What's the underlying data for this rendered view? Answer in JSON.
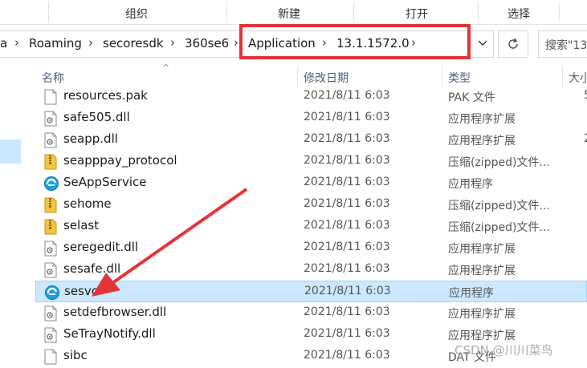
{
  "ribbon": {
    "groups": [
      "组织",
      "新建",
      "打开",
      "选择"
    ]
  },
  "address": {
    "crumbs": [
      "a",
      "Roaming",
      "secoresdk",
      "360se6",
      "Application",
      "13.1.1572.0"
    ]
  },
  "search": {
    "placeholder": "搜索\"13"
  },
  "columns": {
    "name": "名称",
    "date": "修改日期",
    "type": "类型",
    "size": "大小"
  },
  "files": [
    {
      "name": "resources.pak",
      "date": "2021/8/11 6:03",
      "type": "PAK 文件",
      "size": "5",
      "icon": "file-icon"
    },
    {
      "name": "safe505.dll",
      "date": "2021/8/11 6:03",
      "type": "应用程序扩展",
      "size": "",
      "icon": "dll-icon"
    },
    {
      "name": "seapp.dll",
      "date": "2021/8/11 6:03",
      "type": "应用程序扩展",
      "size": "2",
      "icon": "dll-icon"
    },
    {
      "name": "seapppay_protocol",
      "date": "2021/8/11 6:03",
      "type": "压缩(zipped)文件...",
      "size": "",
      "icon": "zip-icon"
    },
    {
      "name": "SeAppService",
      "date": "2021/8/11 6:03",
      "type": "应用程序",
      "size": "",
      "icon": "app-icon"
    },
    {
      "name": "sehome",
      "date": "2021/8/11 6:03",
      "type": "压缩(zipped)文件...",
      "size": "",
      "icon": "zip-icon"
    },
    {
      "name": "selast",
      "date": "2021/8/11 6:03",
      "type": "压缩(zipped)文件...",
      "size": "",
      "icon": "zip-icon"
    },
    {
      "name": "seregedit.dll",
      "date": "2021/8/11 6:03",
      "type": "应用程序扩展",
      "size": "",
      "icon": "dll-icon"
    },
    {
      "name": "sesafe.dll",
      "date": "2021/8/11 6:03",
      "type": "应用程序扩展",
      "size": "",
      "icon": "dll-icon"
    },
    {
      "name": "sesvc",
      "date": "2021/8/11 6:03",
      "type": "应用程序",
      "size": "",
      "icon": "app-icon",
      "selected": true
    },
    {
      "name": "setdefbrowser.dll",
      "date": "2021/8/11 6:03",
      "type": "应用程序扩展",
      "size": "",
      "icon": "dll-icon"
    },
    {
      "name": "SeTrayNotify.dll",
      "date": "2021/8/11 6:03",
      "type": "应用程序扩展",
      "size": "",
      "icon": "dll-icon"
    },
    {
      "name": "sibc",
      "date": "2021/8/11 6:03",
      "type": "DAT 文件",
      "size": "",
      "icon": "file-icon"
    }
  ],
  "watermark": "CSDN @川川菜鸟",
  "colors": {
    "highlight": "#e5333a",
    "selection": "#cce8ff",
    "arrow": "#e5333a"
  }
}
